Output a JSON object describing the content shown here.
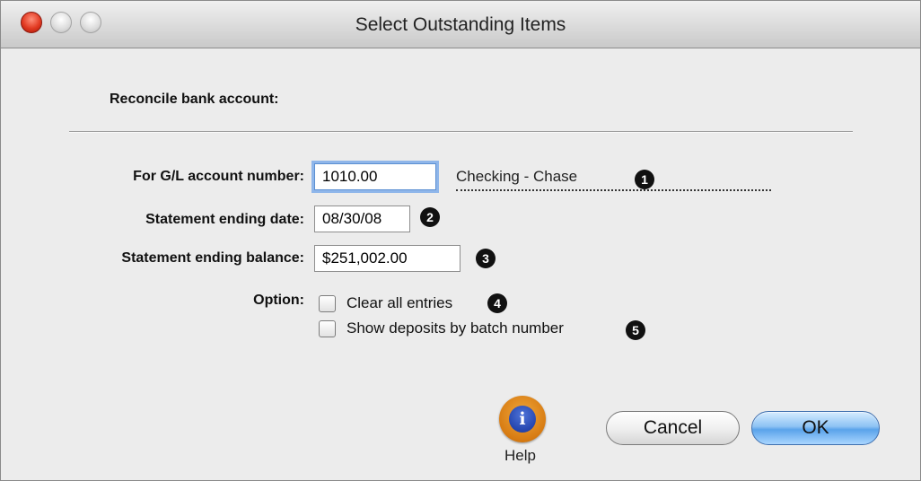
{
  "window": {
    "title": "Select Outstanding Items"
  },
  "header": {
    "section_label": "Reconcile bank account:"
  },
  "form": {
    "gl_account": {
      "label": "For G/L account number:",
      "value": "1010.00",
      "account_name": "Checking - Chase",
      "badge": "1"
    },
    "ending_date": {
      "label": "Statement ending date:",
      "value": "08/30/08",
      "badge": "2"
    },
    "ending_balance": {
      "label": "Statement ending balance:",
      "value": "$251,002.00",
      "badge": "3"
    },
    "option": {
      "label": "Option:",
      "items": [
        {
          "label": "Clear all entries",
          "checked": false,
          "badge": "4"
        },
        {
          "label": "Show deposits by batch number",
          "checked": false,
          "badge": "5"
        }
      ]
    }
  },
  "footer": {
    "help_label": "Help",
    "cancel_label": "Cancel",
    "ok_label": "OK",
    "help_icon": "info-icon"
  },
  "colors": {
    "ok_button": "#5aa3ea",
    "focus_ring": "#8fb6ea",
    "close_button": "#e23a22",
    "help_orange": "#d77b12"
  }
}
